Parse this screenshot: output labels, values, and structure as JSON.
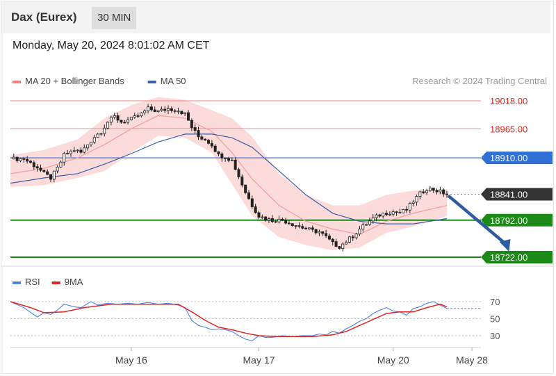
{
  "header": {
    "title": "Dax (Eurex)",
    "interval": "30 MIN",
    "timestamp": "Monday, May 20, 2024 8:01:02 AM CET"
  },
  "colors": {
    "resistance": "#f08080",
    "resistance_text": "#e8231a",
    "pivot": "#3b73d9",
    "pivot_label": "#2f6fd6",
    "support": "#1c8a16",
    "support_label": "#1c8a16",
    "last_label": "#333333",
    "candle": "#222222",
    "ma20": "#f4a0a0",
    "bollinger": "#fbd2d2",
    "ma50": "#3b5fa8",
    "arrow": "#2e5c9e",
    "rsi": "#5b86e0",
    "rsi_ma": "#e02525"
  },
  "chart_data": [
    {
      "type": "candlestick",
      "title": "Dax (Eurex)",
      "legend": [
        {
          "name": "MA 20 + Bollinger Bands",
          "color": "#f08080"
        },
        {
          "name": "MA 50",
          "color": "#3b5fa8"
        }
      ],
      "legend_position": "top-left",
      "credit": "Research © 2024 Trading Central",
      "ylim": [
        18712,
        19026
      ],
      "levels": [
        {
          "value": 19018.0,
          "label": "19018.00",
          "kind": "resistance"
        },
        {
          "value": 18965.0,
          "label": "18965.00",
          "kind": "resistance"
        },
        {
          "value": 18910.0,
          "label": "18910.00",
          "kind": "pivot"
        },
        {
          "value": 18841.0,
          "label": "18841.00",
          "kind": "last"
        },
        {
          "value": 18792.0,
          "label": "18792.00",
          "kind": "support"
        },
        {
          "value": 18722.0,
          "label": "18722.00",
          "kind": "support"
        }
      ],
      "x_ticks": [
        "May 16",
        "May 17",
        "May 20",
        "May 28"
      ],
      "close_path": [
        [
          0,
          18908
        ],
        [
          4,
          18908
        ],
        [
          8,
          18892
        ],
        [
          10,
          18880
        ],
        [
          12,
          18872
        ],
        [
          14,
          18890
        ],
        [
          16,
          18915
        ],
        [
          19,
          18925
        ],
        [
          21,
          18920
        ],
        [
          23,
          18935
        ],
        [
          25,
          18950
        ],
        [
          27,
          18960
        ],
        [
          29,
          18978
        ],
        [
          31,
          18988
        ],
        [
          33,
          18978
        ],
        [
          36,
          18983
        ],
        [
          39,
          18993
        ],
        [
          41,
          19003
        ],
        [
          44,
          18998
        ],
        [
          47,
          19003
        ],
        [
          50,
          19000
        ],
        [
          52,
          18993
        ],
        [
          54,
          18968
        ],
        [
          56,
          18950
        ],
        [
          58,
          18945
        ],
        [
          60,
          18935
        ],
        [
          62,
          18915
        ],
        [
          64,
          18912
        ],
        [
          66,
          18905
        ],
        [
          68,
          18875
        ],
        [
          70,
          18845
        ],
        [
          72,
          18820
        ],
        [
          74,
          18800
        ],
        [
          76,
          18795
        ],
        [
          78,
          18792
        ],
        [
          81,
          18792
        ],
        [
          84,
          18785
        ],
        [
          87,
          18778
        ],
        [
          90,
          18772
        ],
        [
          92,
          18770
        ],
        [
          94,
          18760
        ],
        [
          96,
          18748
        ],
        [
          98,
          18742
        ],
        [
          100,
          18752
        ],
        [
          102,
          18762
        ],
        [
          104,
          18775
        ],
        [
          106,
          18785
        ],
        [
          108,
          18795
        ],
        [
          110,
          18802
        ],
        [
          112,
          18806
        ],
        [
          114,
          18808
        ],
        [
          116,
          18806
        ],
        [
          118,
          18812
        ],
        [
          120,
          18828
        ],
        [
          122,
          18842
        ],
        [
          124,
          18852
        ],
        [
          126,
          18850
        ],
        [
          128,
          18846
        ],
        [
          130,
          18841
        ]
      ],
      "ma20_path": [
        [
          0,
          18880
        ],
        [
          10,
          18890
        ],
        [
          20,
          18910
        ],
        [
          28,
          18935
        ],
        [
          36,
          18965
        ],
        [
          44,
          18990
        ],
        [
          52,
          18985
        ],
        [
          60,
          18960
        ],
        [
          66,
          18920
        ],
        [
          72,
          18870
        ],
        [
          80,
          18820
        ],
        [
          88,
          18790
        ],
        [
          96,
          18775
        ],
        [
          104,
          18765
        ],
        [
          112,
          18790
        ],
        [
          120,
          18805
        ],
        [
          130,
          18820
        ]
      ],
      "bollinger_upper": [
        [
          0,
          18915
        ],
        [
          10,
          18925
        ],
        [
          20,
          18945
        ],
        [
          28,
          18985
        ],
        [
          36,
          19010
        ],
        [
          44,
          19025
        ],
        [
          52,
          19020
        ],
        [
          60,
          19000
        ],
        [
          66,
          18985
        ],
        [
          72,
          18950
        ],
        [
          80,
          18880
        ],
        [
          88,
          18840
        ],
        [
          96,
          18820
        ],
        [
          104,
          18820
        ],
        [
          112,
          18840
        ],
        [
          120,
          18848
        ],
        [
          130,
          18850
        ]
      ],
      "bollinger_lower": [
        [
          0,
          18855
        ],
        [
          10,
          18858
        ],
        [
          20,
          18872
        ],
        [
          28,
          18885
        ],
        [
          36,
          18920
        ],
        [
          44,
          18952
        ],
        [
          52,
          18948
        ],
        [
          60,
          18920
        ],
        [
          66,
          18860
        ],
        [
          72,
          18800
        ],
        [
          80,
          18760
        ],
        [
          88,
          18745
        ],
        [
          96,
          18735
        ],
        [
          104,
          18740
        ],
        [
          112,
          18768
        ],
        [
          120,
          18780
        ],
        [
          130,
          18800
        ]
      ],
      "ma50_path": [
        [
          0,
          18862
        ],
        [
          10,
          18872
        ],
        [
          20,
          18880
        ],
        [
          28,
          18898
        ],
        [
          36,
          18918
        ],
        [
          44,
          18940
        ],
        [
          52,
          18955
        ],
        [
          60,
          18955
        ],
        [
          66,
          18948
        ],
        [
          72,
          18930
        ],
        [
          80,
          18885
        ],
        [
          88,
          18840
        ],
        [
          96,
          18805
        ],
        [
          104,
          18790
        ],
        [
          112,
          18785
        ],
        [
          120,
          18785
        ],
        [
          130,
          18795
        ]
      ],
      "forecast_arrow": {
        "from": [
          130,
          18841
        ],
        "to": [
          139,
          18722
        ]
      }
    },
    {
      "type": "line",
      "legend": [
        {
          "name": "RSI",
          "color": "#5b86e0"
        },
        {
          "name": "9MA",
          "color": "#e02525"
        }
      ],
      "legend_position": "top-left",
      "ylim": [
        22,
        78
      ],
      "y_ticks": [
        "70",
        "50",
        "30"
      ],
      "y_tick_values": [
        70,
        50,
        30
      ],
      "series": [
        {
          "name": "RSI",
          "points": [
            [
              0,
              70
            ],
            [
              4,
              63
            ],
            [
              8,
              52
            ],
            [
              10,
              57
            ],
            [
              12,
              55
            ],
            [
              14,
              60
            ],
            [
              16,
              67
            ],
            [
              19,
              64
            ],
            [
              21,
              63
            ],
            [
              24,
              70
            ],
            [
              26,
              66
            ],
            [
              29,
              68
            ],
            [
              32,
              67
            ],
            [
              35,
              68
            ],
            [
              38,
              67
            ],
            [
              41,
              69
            ],
            [
              44,
              67
            ],
            [
              47,
              68
            ],
            [
              50,
              66
            ],
            [
              52,
              63
            ],
            [
              54,
              48
            ],
            [
              56,
              42
            ],
            [
              58,
              40
            ],
            [
              60,
              37
            ],
            [
              62,
              38
            ],
            [
              64,
              37
            ],
            [
              66,
              35
            ],
            [
              68,
              30
            ],
            [
              70,
              26
            ],
            [
              72,
              24
            ],
            [
              74,
              30
            ],
            [
              76,
              28
            ],
            [
              78,
              28
            ],
            [
              81,
              30
            ],
            [
              84,
              29
            ],
            [
              87,
              30
            ],
            [
              90,
              30
            ],
            [
              92,
              32
            ],
            [
              94,
              31
            ],
            [
              96,
              35
            ],
            [
              98,
              33
            ],
            [
              100,
              38
            ],
            [
              102,
              42
            ],
            [
              104,
              47
            ],
            [
              106,
              50
            ],
            [
              108,
              56
            ],
            [
              110,
              60
            ],
            [
              112,
              63
            ],
            [
              114,
              59
            ],
            [
              116,
              58
            ],
            [
              118,
              54
            ],
            [
              120,
              62
            ],
            [
              122,
              64
            ],
            [
              124,
              68
            ],
            [
              126,
              70
            ],
            [
              128,
              66
            ],
            [
              130,
              62
            ]
          ]
        },
        {
          "name": "9MA",
          "points": [
            [
              0,
              70
            ],
            [
              6,
              63
            ],
            [
              10,
              57
            ],
            [
              16,
              58
            ],
            [
              22,
              63
            ],
            [
              30,
              67
            ],
            [
              40,
              67
            ],
            [
              50,
              67
            ],
            [
              54,
              58
            ],
            [
              58,
              48
            ],
            [
              62,
              40
            ],
            [
              66,
              37
            ],
            [
              70,
              33
            ],
            [
              74,
              30
            ],
            [
              80,
              29
            ],
            [
              90,
              29
            ],
            [
              96,
              31
            ],
            [
              100,
              35
            ],
            [
              104,
              42
            ],
            [
              108,
              49
            ],
            [
              112,
              56
            ],
            [
              116,
              58
            ],
            [
              120,
              58
            ],
            [
              124,
              63
            ],
            [
              128,
              67
            ],
            [
              130,
              64
            ]
          ]
        }
      ],
      "projection": 62
    }
  ]
}
